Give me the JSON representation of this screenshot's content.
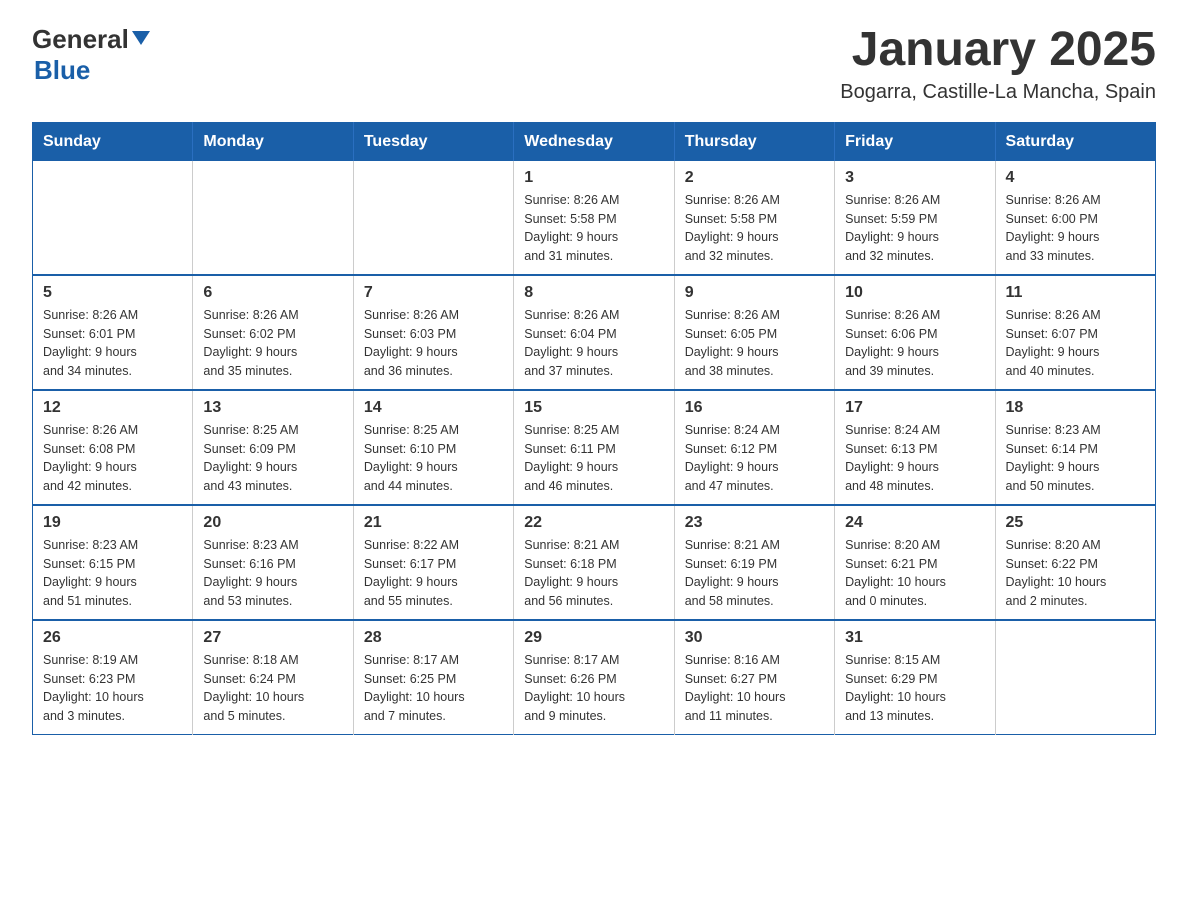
{
  "header": {
    "logo_general": "General",
    "logo_blue": "Blue",
    "title": "January 2025",
    "subtitle": "Bogarra, Castille-La Mancha, Spain"
  },
  "days_of_week": [
    "Sunday",
    "Monday",
    "Tuesday",
    "Wednesday",
    "Thursday",
    "Friday",
    "Saturday"
  ],
  "weeks": [
    [
      {
        "day": "",
        "info": ""
      },
      {
        "day": "",
        "info": ""
      },
      {
        "day": "",
        "info": ""
      },
      {
        "day": "1",
        "info": "Sunrise: 8:26 AM\nSunset: 5:58 PM\nDaylight: 9 hours\nand 31 minutes."
      },
      {
        "day": "2",
        "info": "Sunrise: 8:26 AM\nSunset: 5:58 PM\nDaylight: 9 hours\nand 32 minutes."
      },
      {
        "day": "3",
        "info": "Sunrise: 8:26 AM\nSunset: 5:59 PM\nDaylight: 9 hours\nand 32 minutes."
      },
      {
        "day": "4",
        "info": "Sunrise: 8:26 AM\nSunset: 6:00 PM\nDaylight: 9 hours\nand 33 minutes."
      }
    ],
    [
      {
        "day": "5",
        "info": "Sunrise: 8:26 AM\nSunset: 6:01 PM\nDaylight: 9 hours\nand 34 minutes."
      },
      {
        "day": "6",
        "info": "Sunrise: 8:26 AM\nSunset: 6:02 PM\nDaylight: 9 hours\nand 35 minutes."
      },
      {
        "day": "7",
        "info": "Sunrise: 8:26 AM\nSunset: 6:03 PM\nDaylight: 9 hours\nand 36 minutes."
      },
      {
        "day": "8",
        "info": "Sunrise: 8:26 AM\nSunset: 6:04 PM\nDaylight: 9 hours\nand 37 minutes."
      },
      {
        "day": "9",
        "info": "Sunrise: 8:26 AM\nSunset: 6:05 PM\nDaylight: 9 hours\nand 38 minutes."
      },
      {
        "day": "10",
        "info": "Sunrise: 8:26 AM\nSunset: 6:06 PM\nDaylight: 9 hours\nand 39 minutes."
      },
      {
        "day": "11",
        "info": "Sunrise: 8:26 AM\nSunset: 6:07 PM\nDaylight: 9 hours\nand 40 minutes."
      }
    ],
    [
      {
        "day": "12",
        "info": "Sunrise: 8:26 AM\nSunset: 6:08 PM\nDaylight: 9 hours\nand 42 minutes."
      },
      {
        "day": "13",
        "info": "Sunrise: 8:25 AM\nSunset: 6:09 PM\nDaylight: 9 hours\nand 43 minutes."
      },
      {
        "day": "14",
        "info": "Sunrise: 8:25 AM\nSunset: 6:10 PM\nDaylight: 9 hours\nand 44 minutes."
      },
      {
        "day": "15",
        "info": "Sunrise: 8:25 AM\nSunset: 6:11 PM\nDaylight: 9 hours\nand 46 minutes."
      },
      {
        "day": "16",
        "info": "Sunrise: 8:24 AM\nSunset: 6:12 PM\nDaylight: 9 hours\nand 47 minutes."
      },
      {
        "day": "17",
        "info": "Sunrise: 8:24 AM\nSunset: 6:13 PM\nDaylight: 9 hours\nand 48 minutes."
      },
      {
        "day": "18",
        "info": "Sunrise: 8:23 AM\nSunset: 6:14 PM\nDaylight: 9 hours\nand 50 minutes."
      }
    ],
    [
      {
        "day": "19",
        "info": "Sunrise: 8:23 AM\nSunset: 6:15 PM\nDaylight: 9 hours\nand 51 minutes."
      },
      {
        "day": "20",
        "info": "Sunrise: 8:23 AM\nSunset: 6:16 PM\nDaylight: 9 hours\nand 53 minutes."
      },
      {
        "day": "21",
        "info": "Sunrise: 8:22 AM\nSunset: 6:17 PM\nDaylight: 9 hours\nand 55 minutes."
      },
      {
        "day": "22",
        "info": "Sunrise: 8:21 AM\nSunset: 6:18 PM\nDaylight: 9 hours\nand 56 minutes."
      },
      {
        "day": "23",
        "info": "Sunrise: 8:21 AM\nSunset: 6:19 PM\nDaylight: 9 hours\nand 58 minutes."
      },
      {
        "day": "24",
        "info": "Sunrise: 8:20 AM\nSunset: 6:21 PM\nDaylight: 10 hours\nand 0 minutes."
      },
      {
        "day": "25",
        "info": "Sunrise: 8:20 AM\nSunset: 6:22 PM\nDaylight: 10 hours\nand 2 minutes."
      }
    ],
    [
      {
        "day": "26",
        "info": "Sunrise: 8:19 AM\nSunset: 6:23 PM\nDaylight: 10 hours\nand 3 minutes."
      },
      {
        "day": "27",
        "info": "Sunrise: 8:18 AM\nSunset: 6:24 PM\nDaylight: 10 hours\nand 5 minutes."
      },
      {
        "day": "28",
        "info": "Sunrise: 8:17 AM\nSunset: 6:25 PM\nDaylight: 10 hours\nand 7 minutes."
      },
      {
        "day": "29",
        "info": "Sunrise: 8:17 AM\nSunset: 6:26 PM\nDaylight: 10 hours\nand 9 minutes."
      },
      {
        "day": "30",
        "info": "Sunrise: 8:16 AM\nSunset: 6:27 PM\nDaylight: 10 hours\nand 11 minutes."
      },
      {
        "day": "31",
        "info": "Sunrise: 8:15 AM\nSunset: 6:29 PM\nDaylight: 10 hours\nand 13 minutes."
      },
      {
        "day": "",
        "info": ""
      }
    ]
  ]
}
